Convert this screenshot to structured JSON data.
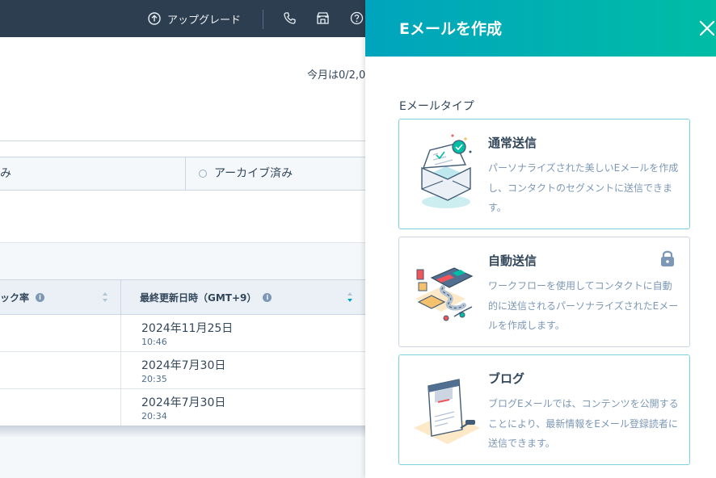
{
  "nav": {
    "upgrade_label": "アップグレード",
    "icons": [
      "upgrade-icon",
      "phone-icon",
      "marketplace-icon",
      "help-icon"
    ]
  },
  "background": {
    "usage_text": "今月は0/2,0",
    "filters": {
      "tab1_label": "み",
      "tab2_label": "アーカイブ済み"
    },
    "table": {
      "headers": [
        "ック率",
        "最終更新日時（GMT+9）"
      ],
      "rows": [
        {
          "date": "2024年11月25日",
          "time": "10:46"
        },
        {
          "date": "2024年7月30日",
          "time": "20:35"
        },
        {
          "date": "2024年7月30日",
          "time": "20:34"
        }
      ]
    }
  },
  "panel": {
    "title": "Eメールを作成",
    "section_label": "Eメールタイプ",
    "cards": [
      {
        "title": "通常送信",
        "description": "パーソナライズされた美しいEメールを作成し、コンタクトのセグメントに送信できます。",
        "illustration": "envelope-check-illustration",
        "locked": false
      },
      {
        "title": "自動送信",
        "description": "ワークフローを使用してコンタクトに自動的に送信されるパーソナライズされたEメールを作成します。",
        "illustration": "workflow-illustration",
        "locked": true
      },
      {
        "title": "ブログ",
        "description": "ブログEメールでは、コンテンツを公開することにより、最新情報をEメール登録読者に送信できます。",
        "illustration": "blog-illustration",
        "locked": false
      }
    ]
  },
  "colors": {
    "nav_bg": "#2d3e50",
    "header_start": "#00a4bd",
    "header_end": "#00bda5",
    "card_border": "#7fd1de",
    "text": "#33475b",
    "muted_text": "#7c98b6"
  }
}
